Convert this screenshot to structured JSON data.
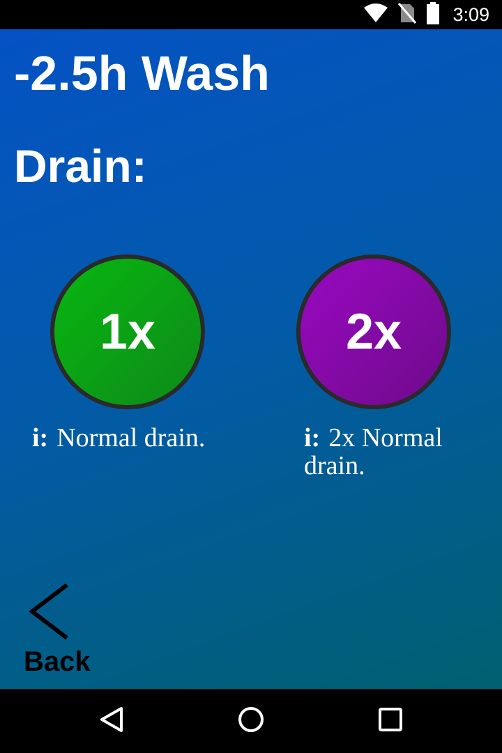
{
  "status_bar": {
    "time": "3:09",
    "icons": [
      "wifi-icon",
      "no-sim-icon",
      "battery-icon"
    ]
  },
  "screen": {
    "title": "-2.5h Wash",
    "subtitle": "Drain:",
    "options": [
      {
        "label": "1x",
        "color": "#0a9e14",
        "info_mark": "i:",
        "info_text": "Normal drain."
      },
      {
        "label": "2x",
        "color": "#8a0aaa",
        "info_mark": "i:",
        "info_text": "2x Normal drain."
      }
    ],
    "back_label": "Back"
  },
  "nav_bar": {
    "icons": [
      "nav-back-icon",
      "nav-home-icon",
      "nav-recents-icon"
    ]
  }
}
